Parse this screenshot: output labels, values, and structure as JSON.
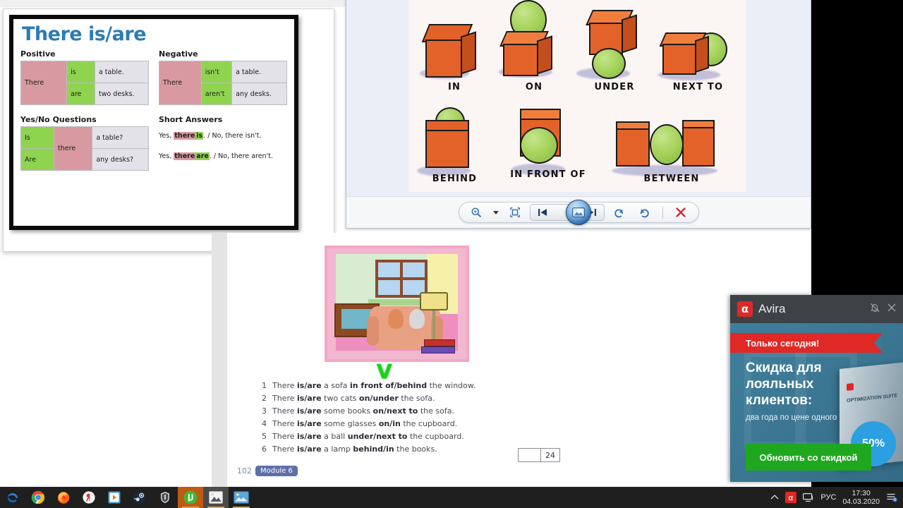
{
  "grammar_slide": {
    "title": "There is/are",
    "positive": {
      "heading": "Positive",
      "subject": "There",
      "rows": [
        {
          "verb": "is",
          "object": "a table."
        },
        {
          "verb": "are",
          "object": "two desks."
        }
      ]
    },
    "negative": {
      "heading": "Negative",
      "subject": "There",
      "rows": [
        {
          "verb": "isn't",
          "object": "a table."
        },
        {
          "verb": "aren't",
          "object": "any desks."
        }
      ]
    },
    "questions": {
      "heading": "Yes/No Questions",
      "subject": "there",
      "rows": [
        {
          "verb": "Is",
          "object": "a table?"
        },
        {
          "verb": "Are",
          "object": "any desks?"
        }
      ]
    },
    "short_answers": {
      "heading": "Short Answers",
      "lines": [
        {
          "yes": "Yes,",
          "there": "there",
          "verb": "is",
          "rest": ". / No, there isn't."
        },
        {
          "yes": "Yes,",
          "there": "there",
          "verb": "are",
          "rest": ". / No, there aren't."
        }
      ]
    },
    "resize_handle_icon": "resize-diagonal-icon"
  },
  "photo_viewer": {
    "image_title": "prepositions-of-place",
    "prepositions": [
      {
        "label": "IN"
      },
      {
        "label": "ON"
      },
      {
        "label": "UNDER"
      },
      {
        "label": "NEXT TO"
      },
      {
        "label": "BEHIND"
      },
      {
        "label": "IN FRONT OF"
      },
      {
        "label": "BETWEEN"
      }
    ],
    "toolbar": {
      "zoom_label": "Zoom",
      "fit_label": "Fit to window",
      "previous_label": "Previous",
      "play_label": "Play slide show",
      "next_label": "Next",
      "rotate_ccw_label": "Rotate counterclockwise",
      "rotate_cw_label": "Rotate clockwise",
      "delete_label": "Delete"
    }
  },
  "workbook": {
    "exercise_items": [
      {
        "num": "1",
        "pre": "There ",
        "verb": "is/are",
        "mid": " a sofa ",
        "prep": "in front of/behind",
        "post": " the window."
      },
      {
        "num": "2",
        "pre": "There ",
        "verb": "is/are",
        "mid": " two cats ",
        "prep": "on/under",
        "post": " the sofa."
      },
      {
        "num": "3",
        "pre": "There ",
        "verb": "is/are",
        "mid": " some books ",
        "prep": "on/next to",
        "post": " the sofa."
      },
      {
        "num": "4",
        "pre": "There ",
        "verb": "is/are",
        "mid": " some glasses ",
        "prep": "on/in",
        "post": " the cupboard."
      },
      {
        "num": "5",
        "pre": "There ",
        "verb": "is/are",
        "mid": " a ball ",
        "prep": "under/next to",
        "post": " the cupboard."
      },
      {
        "num": "6",
        "pre": "There ",
        "verb": "is/are",
        "mid": " a lamp ",
        "prep": "behind/in",
        "post": " the books."
      }
    ],
    "score_blank": "",
    "score_total": "24",
    "page_number": "102",
    "module_label": "Module 6",
    "checkmark": "V",
    "picture_name": "living-room-illustration"
  },
  "avira_popup": {
    "app_name": "Avira",
    "logo_glyph": "α",
    "mute_icon": "bell-muted-icon",
    "close_icon": "close-icon",
    "ribbon_text": "Только сегодня!",
    "headline": "Скидка для лояльных клиентов:",
    "subtext": "два года по цене одного",
    "cta_label": "Обновить со скидкой",
    "discount_badge": "50%",
    "product_box_label": "OPTIMIZATION SUITE"
  },
  "taskbar": {
    "apps": [
      {
        "name": "edge",
        "glyph": "e",
        "state": "idle"
      },
      {
        "name": "chrome",
        "glyph": "",
        "state": "idle"
      },
      {
        "name": "firefox",
        "glyph": "",
        "state": "idle"
      },
      {
        "name": "yandex",
        "glyph": "Y",
        "state": "idle"
      },
      {
        "name": "media-player",
        "glyph": "▶",
        "state": "idle"
      },
      {
        "name": "steam",
        "glyph": "",
        "state": "idle"
      },
      {
        "name": "world-of-tanks",
        "glyph": "",
        "state": "idle"
      },
      {
        "name": "utorrent",
        "glyph": "µ",
        "state": "active-orange"
      },
      {
        "name": "photo-viewer",
        "glyph": "",
        "state": "active-grey"
      },
      {
        "name": "image-app",
        "glyph": "",
        "state": "running"
      }
    ],
    "tray": {
      "chevron_icon": "chevron-up-icon",
      "avira_icon": "avira-tray-icon",
      "network_icon": "network-icon",
      "language": "РУС",
      "time": "17:30",
      "date": "04.03.2020",
      "notifications_icon": "action-center-icon",
      "notification_count": "6"
    }
  }
}
